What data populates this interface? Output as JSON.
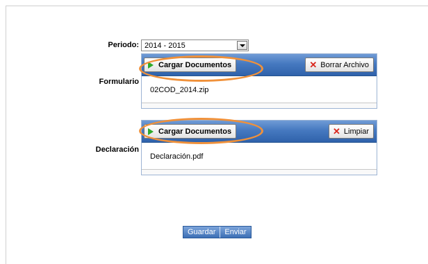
{
  "periodo": {
    "label": "Periodo:",
    "selected": "2014 - 2015",
    "dropdown_icon": "chevron-down-icon"
  },
  "formulario": {
    "label": "Formulario",
    "upload_label": "Cargar Documentos",
    "upload_icon": "play-icon",
    "clear_label": "Borrar Archivo",
    "clear_icon": "x-icon",
    "file_name": "02COD_2014.zip"
  },
  "declaracion": {
    "label": "Declaración",
    "upload_label": "Cargar Documentos",
    "upload_icon": "play-icon",
    "clear_label": "Limpiar",
    "clear_icon": "x-icon",
    "file_name": "Declaración.pdf"
  },
  "actions": {
    "save_label": "Guardar",
    "send_label": "Enviar"
  },
  "colors": {
    "panel_bar": "#4679c0",
    "highlight_ring": "#f0913a",
    "play_icon": "#2eaa2a",
    "clear_icon": "#d9251b"
  }
}
